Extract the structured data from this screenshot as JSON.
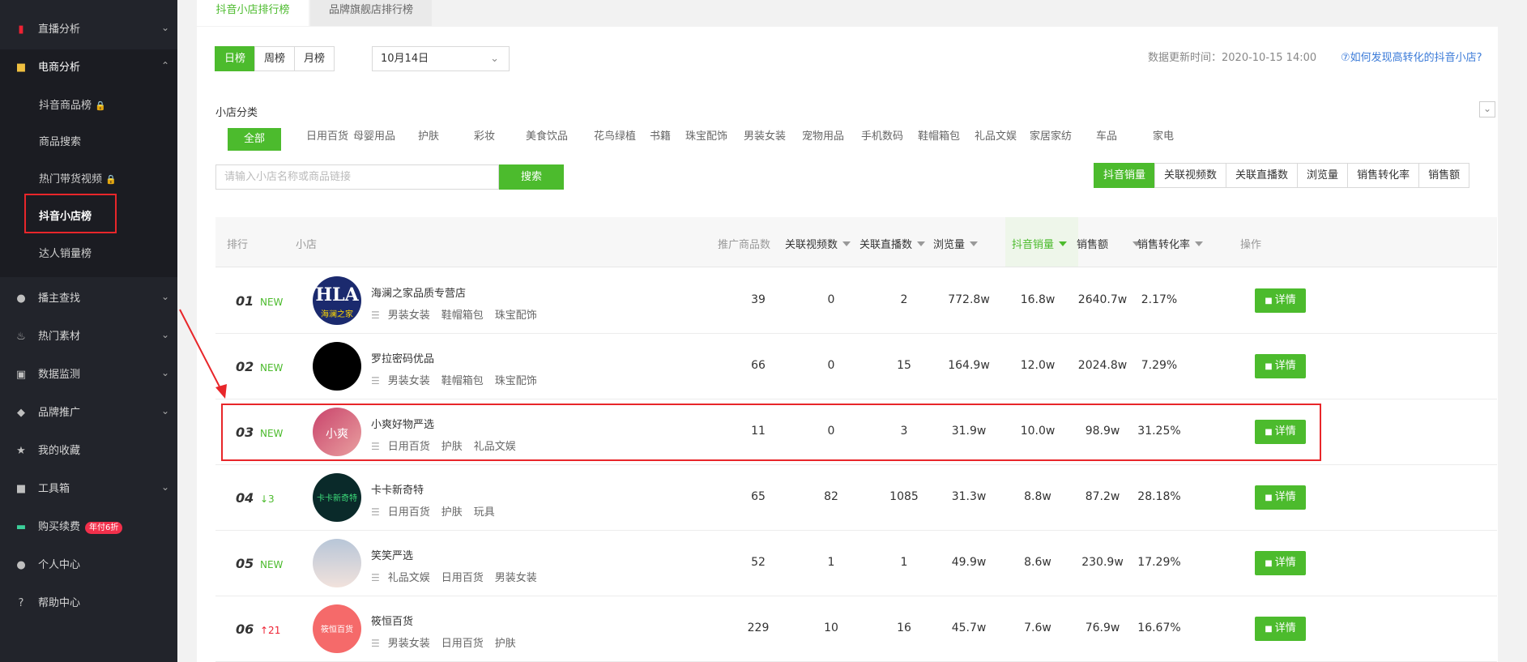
{
  "sidebar": {
    "live_analysis": "直播分析",
    "ecom_analysis": "电商分析",
    "sub": [
      "抖音商品榜",
      "商品搜索",
      "热门带货视频",
      "抖音小店榜",
      "达人销量榜"
    ],
    "host_search": "播主查找",
    "hot_material": "热门素材",
    "data_monitor": "数据监测",
    "brand_promo": "品牌推广",
    "favorites": "我的收藏",
    "toolbox": "工具箱",
    "purchase": "购买续费",
    "purchase_badge": "年付6折",
    "personal": "个人中心",
    "help": "帮助中心"
  },
  "tabs": [
    "抖音小店排行榜",
    "品牌旗舰店排行榜"
  ],
  "period_tabs": [
    "日榜",
    "周榜",
    "月榜"
  ],
  "date": "10月14日",
  "update_time": "数据更新时间：2020-10-15 14:00",
  "help_link": "⑦如何发现高转化的抖音小店?",
  "category_label": "小店分类",
  "categories": [
    "全部",
    "日用百货",
    "母婴用品",
    "护肤",
    "彩妆",
    "美食饮品",
    "花鸟绿植",
    "书籍",
    "珠宝配饰",
    "男装女装",
    "宠物用品",
    "手机数码",
    "鞋帽箱包",
    "礼品文娱",
    "家居家纺",
    "车品",
    "家电"
  ],
  "search": {
    "placeholder": "请输入小店名称或商品链接",
    "button": "搜索"
  },
  "sort_tabs": [
    "抖音销量",
    "关联视频数",
    "关联直播数",
    "浏览量",
    "销售转化率",
    "销售额"
  ],
  "columns": [
    "排行",
    "小店",
    "推广商品数",
    "关联视频数",
    "关联直播数",
    "浏览量",
    "抖音销量",
    "销售额",
    "销售转化率",
    "操作"
  ],
  "detail_label": "详情",
  "rows": [
    {
      "rank": "01",
      "trend": "NEW",
      "name": "海澜之家品质专营店",
      "tags": [
        "男装女装",
        "鞋帽箱包",
        "珠宝配饰"
      ],
      "promo": "39",
      "videos": "0",
      "lives": "2",
      "views": "772.8w",
      "sales": "16.8w",
      "revenue": "2640.7w",
      "conv": "2.17%",
      "avatar_text": "HLA",
      "avatar_sub": "海澜之家"
    },
    {
      "rank": "02",
      "trend": "NEW",
      "name": "罗拉密码优品",
      "tags": [
        "男装女装",
        "鞋帽箱包",
        "珠宝配饰"
      ],
      "promo": "66",
      "videos": "0",
      "lives": "15",
      "views": "164.9w",
      "sales": "12.0w",
      "revenue": "2024.8w",
      "conv": "7.29%",
      "avatar_text": "",
      "avatar_sub": ""
    },
    {
      "rank": "03",
      "trend": "NEW",
      "name": "小爽好物严选",
      "tags": [
        "日用百货",
        "护肤",
        "礼品文娱"
      ],
      "promo": "11",
      "videos": "0",
      "lives": "3",
      "views": "31.9w",
      "sales": "10.0w",
      "revenue": "98.9w",
      "conv": "31.25%",
      "avatar_text": "小爽",
      "avatar_sub": ""
    },
    {
      "rank": "04",
      "trend": "↓3",
      "name": "卡卡新奇特",
      "tags": [
        "日用百货",
        "护肤",
        "玩具"
      ],
      "promo": "65",
      "videos": "82",
      "lives": "1085",
      "views": "31.3w",
      "sales": "8.8w",
      "revenue": "87.2w",
      "conv": "28.18%",
      "avatar_text": "卡卡新奇特",
      "avatar_sub": ""
    },
    {
      "rank": "05",
      "trend": "NEW",
      "name": "笑笑严选",
      "tags": [
        "礼品文娱",
        "日用百货",
        "男装女装"
      ],
      "promo": "52",
      "videos": "1",
      "lives": "1",
      "views": "49.9w",
      "sales": "8.6w",
      "revenue": "230.9w",
      "conv": "17.29%",
      "avatar_text": "",
      "avatar_sub": ""
    },
    {
      "rank": "06",
      "trend": "↑21",
      "name": "筱恒百货",
      "tags": [
        "男装女装",
        "日用百货",
        "护肤"
      ],
      "promo": "229",
      "videos": "10",
      "lives": "16",
      "views": "45.7w",
      "sales": "7.6w",
      "revenue": "76.9w",
      "conv": "16.67%",
      "avatar_text": "筱恒百货",
      "avatar_sub": ""
    }
  ],
  "colors": {
    "accent": "#4cbb2d",
    "highlight": "#e8262a",
    "sidebar": "#22242b"
  }
}
